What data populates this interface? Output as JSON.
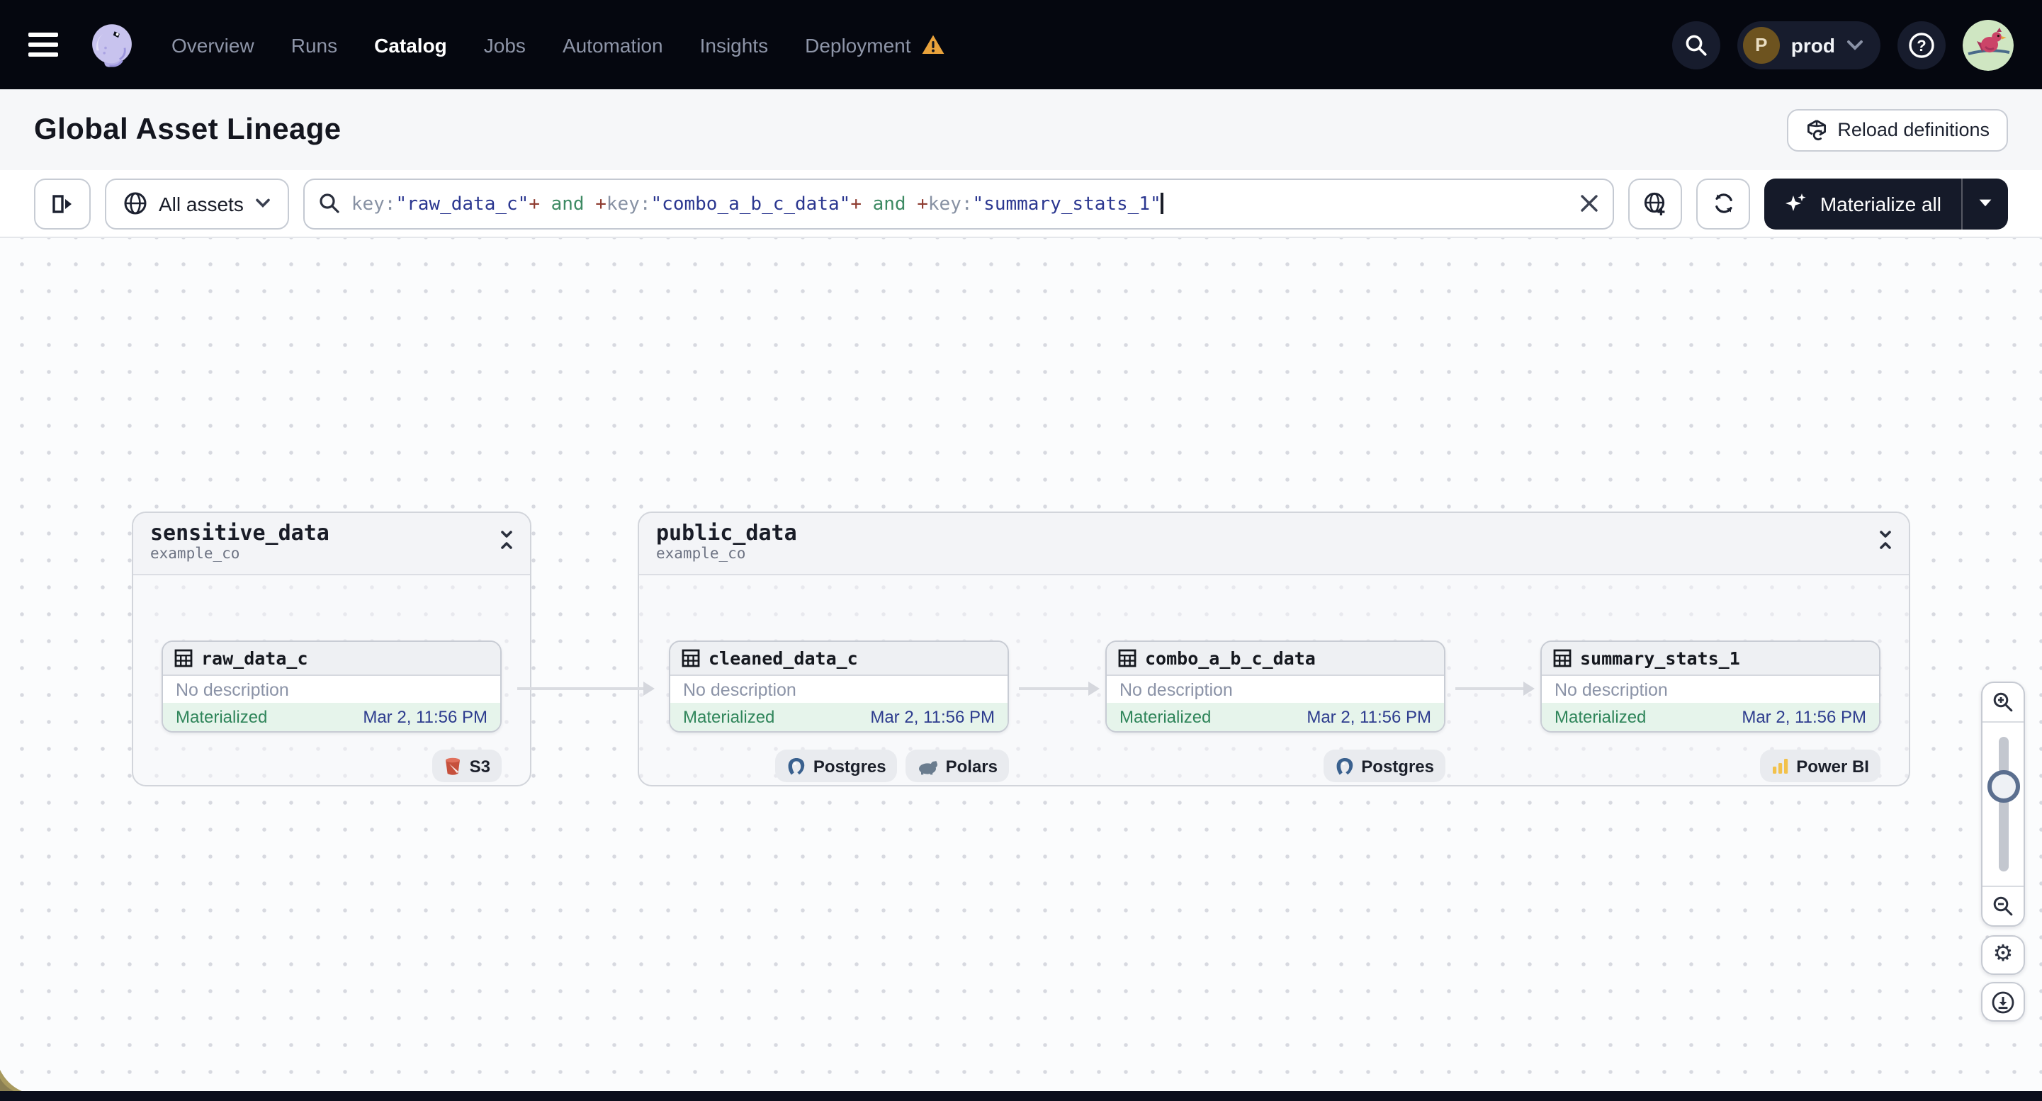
{
  "nav": {
    "items": [
      "Overview",
      "Runs",
      "Catalog",
      "Jobs",
      "Automation",
      "Insights",
      "Deployment"
    ],
    "active_item": "Catalog",
    "deployment_pill": {
      "avatar_initial": "P",
      "label": "prod"
    }
  },
  "header": {
    "title": "Global Asset Lineage",
    "reload_button_label": "Reload definitions"
  },
  "toolbar": {
    "scope_label": "All assets",
    "materialize_label": "Materialize all",
    "query": [
      {
        "t": "key:",
        "c": "attr"
      },
      {
        "t": "\"raw_data_c\"",
        "c": "str"
      },
      {
        "t": "+",
        "c": "op"
      },
      {
        "t": " and ",
        "c": "kw"
      },
      {
        "t": "+",
        "c": "op"
      },
      {
        "t": "key:",
        "c": "attr"
      },
      {
        "t": "\"combo_a_b_c_data\"",
        "c": "str"
      },
      {
        "t": "+",
        "c": "op"
      },
      {
        "t": " and ",
        "c": "kw"
      },
      {
        "t": "+",
        "c": "op"
      },
      {
        "t": "key:",
        "c": "attr"
      },
      {
        "t": "\"summary_stats_1\"",
        "c": "str"
      }
    ]
  },
  "graph": {
    "groups": [
      {
        "name": "sensitive_data",
        "repo": "example_co",
        "assets": [
          {
            "name": "raw_data_c",
            "description": "No description",
            "status": "Materialized",
            "time": "Mar 2, 11:56 PM",
            "badges": [
              "S3"
            ]
          }
        ]
      },
      {
        "name": "public_data",
        "repo": "example_co",
        "assets": [
          {
            "name": "cleaned_data_c",
            "description": "No description",
            "status": "Materialized",
            "time": "Mar 2, 11:56 PM",
            "badges": [
              "Postgres",
              "Polars"
            ]
          },
          {
            "name": "combo_a_b_c_data",
            "description": "No description",
            "status": "Materialized",
            "time": "Mar 2, 11:56 PM",
            "badges": [
              "Postgres"
            ]
          },
          {
            "name": "summary_stats_1",
            "description": "No description",
            "status": "Materialized",
            "time": "Mar 2, 11:56 PM",
            "badges": [
              "Power BI"
            ]
          }
        ]
      }
    ]
  },
  "colors": {
    "nav_bg": "#05070f",
    "materialize_bg": "#151a29",
    "status_green": "#2f855a",
    "status_footer_bg": "#e6f4eb",
    "timestamp_blue": "#2d3c8e",
    "query_attr": "#8791a3",
    "query_string": "#2b3790",
    "query_operator": "#8f3d31",
    "query_keyword": "#3d8a63",
    "warning_amber": "#e9a23b",
    "edge_gray": "#dadce1"
  }
}
